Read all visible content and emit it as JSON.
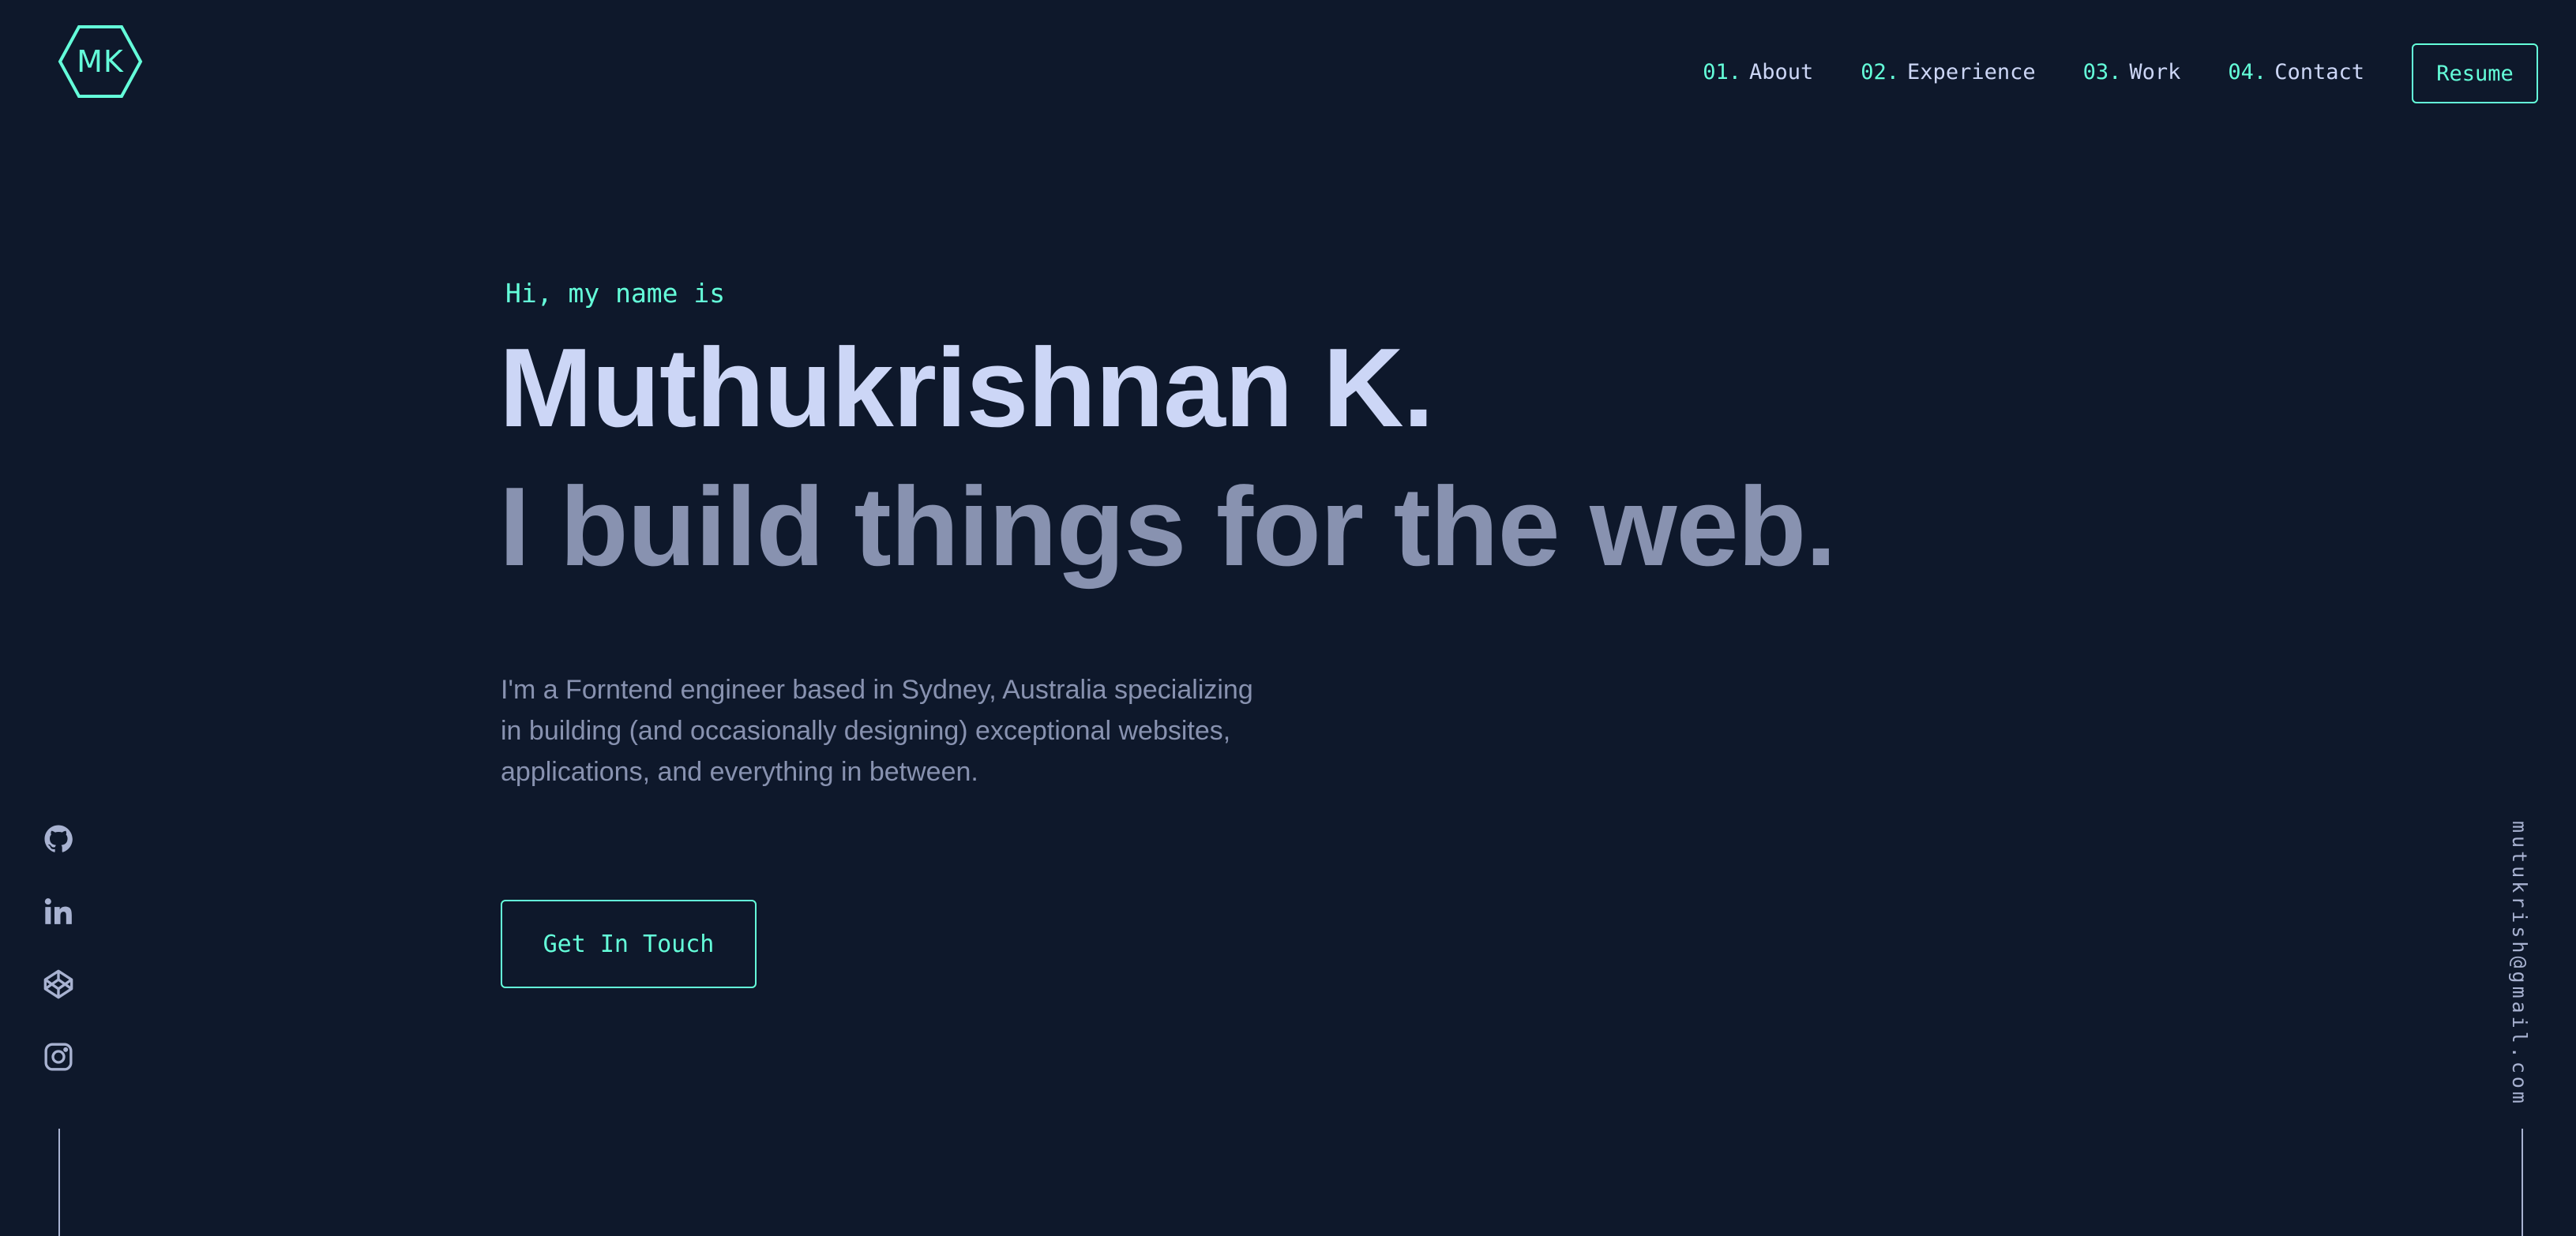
{
  "header": {
    "logo_text": "MK",
    "nav": [
      {
        "num": "01.",
        "label": "About"
      },
      {
        "num": "02.",
        "label": "Experience"
      },
      {
        "num": "03.",
        "label": "Work"
      },
      {
        "num": "04.",
        "label": "Contact"
      }
    ],
    "resume_label": "Resume"
  },
  "hero": {
    "greeting": "Hi, my name is",
    "name": "Muthukrishnan K.",
    "tagline": "I build things for the web.",
    "description": "I'm a Forntend engineer based in Sydney, Australia specializing in building (and occasionally designing) exceptional websites, applications, and everything in between.",
    "cta_label": "Get In Touch"
  },
  "social": {
    "icons": [
      "github-icon",
      "linkedin-icon",
      "codepen-icon",
      "instagram-icon"
    ]
  },
  "email": "mutukrish@gmail.com",
  "colors": {
    "background": "#0e182b",
    "accent": "#64ffda",
    "heading": "#ccd6f6",
    "body_text": "#8892b0"
  }
}
